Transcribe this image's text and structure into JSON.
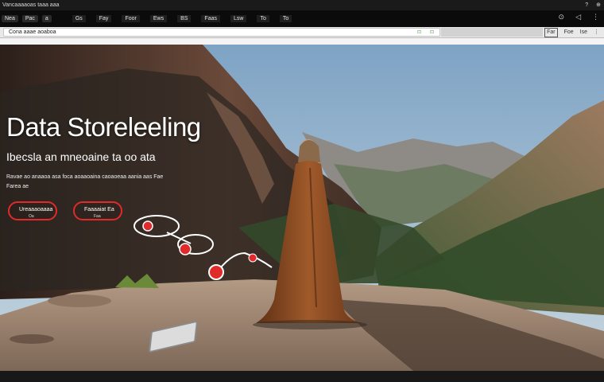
{
  "titlebar": {
    "text": "Vancaaaaoas  taaa aaa",
    "sys_icons": [
      "question-icon",
      "close-icon"
    ],
    "sys_glyphs": [
      "?",
      "⊕"
    ]
  },
  "menubar": {
    "left_items": [
      "Nea",
      "Pac",
      "a"
    ],
    "mid_items": [
      "Gs",
      "Fay",
      "Foor",
      "Ews",
      "BS",
      "Faas",
      "Lsw",
      "To",
      "To"
    ],
    "right_glyphs": [
      "⊙",
      "◁",
      "⋮"
    ]
  },
  "urlbar": {
    "address": "Cona aaae aoaboa",
    "mini_icons": [
      "⊡",
      "⊡"
    ],
    "tools": [
      "Far",
      "Foe",
      "Ise",
      "⋮"
    ]
  },
  "hero": {
    "title": "Data Storeleeling",
    "subtitle": "Ibecsla an  mneoaine ta oo ata",
    "body_line1": "Ravae ao anaaoa asa foca aoaaoaina caoaoeaa  aania aas  Fae",
    "body_line2": "Farea ae",
    "pill1_label": "Ureaaaoaaaa",
    "pill1_small": "Oa",
    "pill2_label": "Faaaaiat  Ea",
    "pill2_small": "Faa"
  },
  "colors": {
    "accent_red": "#e12a2a",
    "sky_top": "#7ea3c4",
    "sky_bottom": "#c7d6df",
    "cloak": "#8a4a22",
    "rock": "#a08570"
  }
}
